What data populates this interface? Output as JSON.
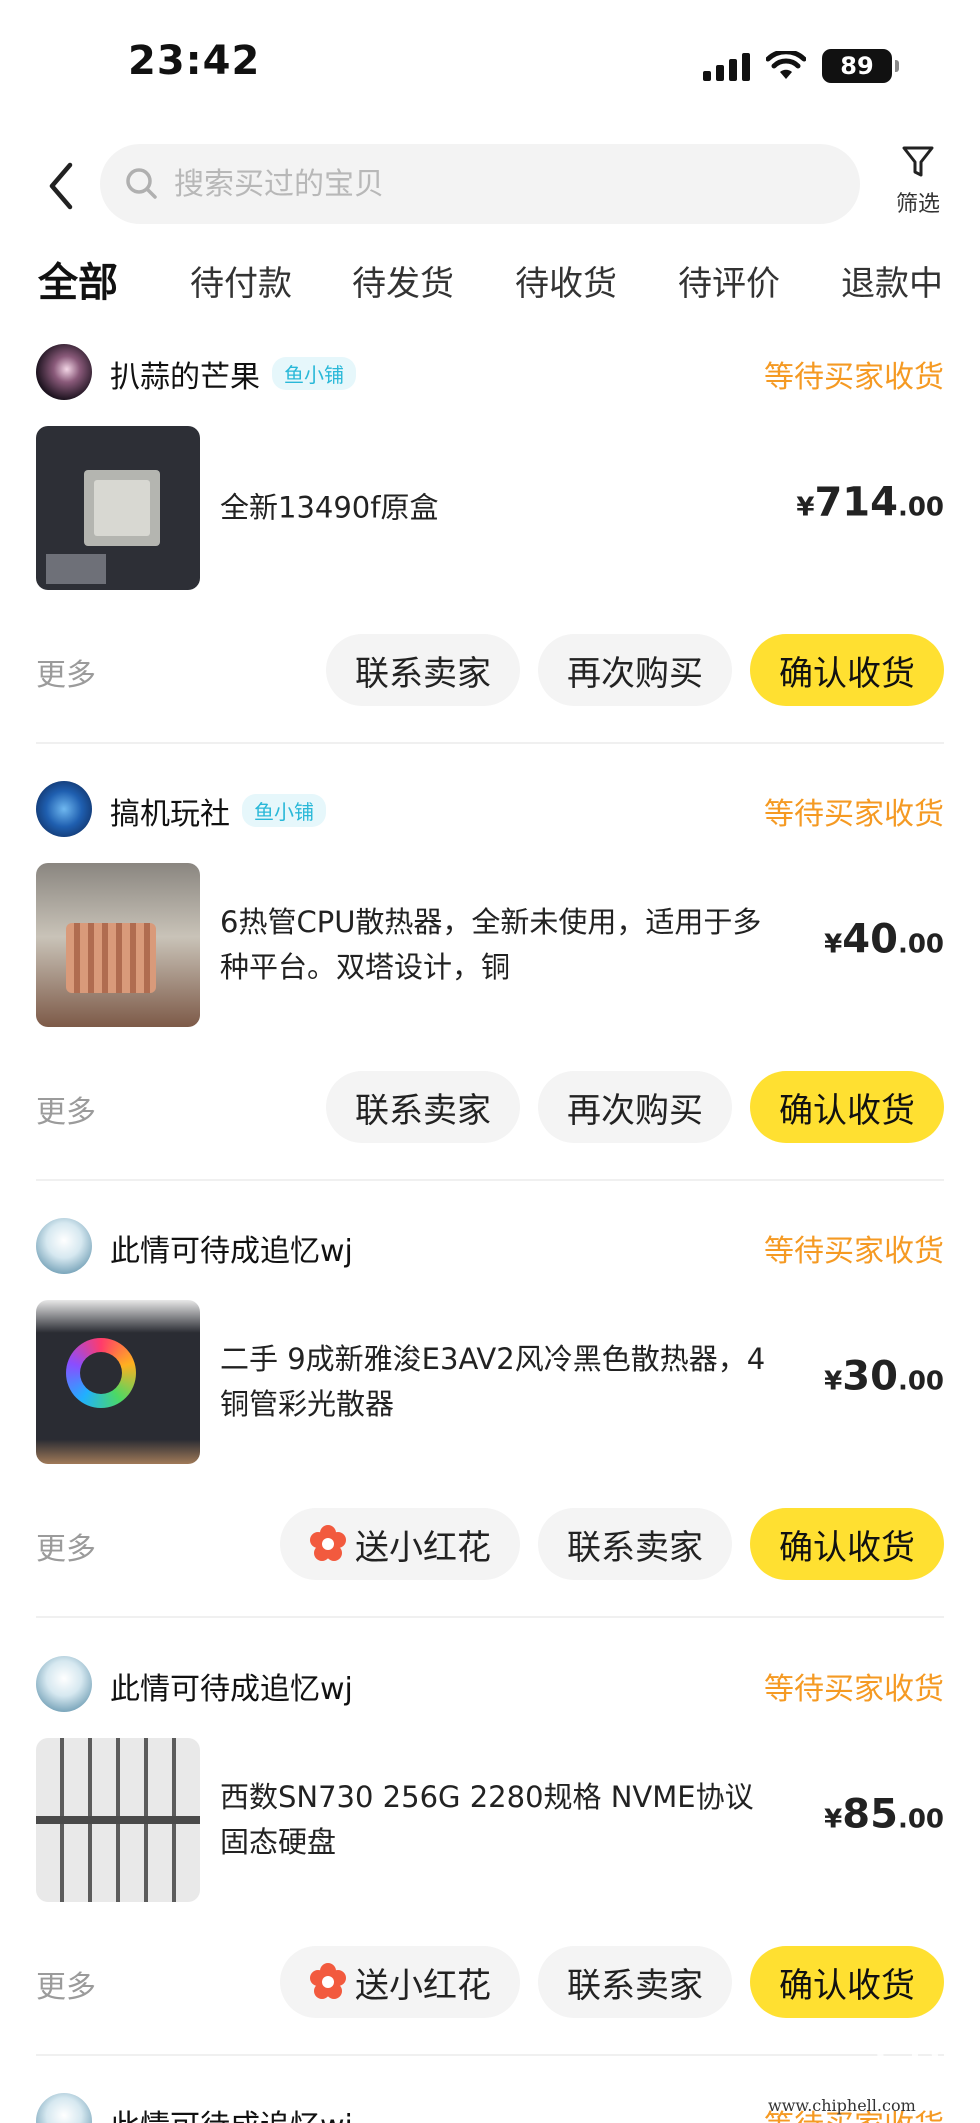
{
  "status_bar": {
    "time": "23:42",
    "battery": "89"
  },
  "search": {
    "placeholder": "搜索买过的宝贝",
    "filter_label": "筛选"
  },
  "tabs": [
    {
      "label": "全部",
      "active": true
    },
    {
      "label": "待付款"
    },
    {
      "label": "待发货"
    },
    {
      "label": "待收货"
    },
    {
      "label": "待评价"
    },
    {
      "label": "退款中"
    }
  ],
  "orders": [
    {
      "shop": "扒蒜的芒果",
      "badge": "鱼小铺",
      "status": "等待买家收货",
      "title": "全新13490f原盒",
      "price_symbol": "¥",
      "price_int": "714",
      "price_dec": ".00",
      "more": "更多",
      "buttons": [
        "联系卖家",
        "再次购买",
        "确认收货"
      ]
    },
    {
      "shop": "搞机玩社",
      "badge": "鱼小铺",
      "status": "等待买家收货",
      "title": "6热管CPU散热器，全新未使用，适用于多种平台。双塔设计，铜",
      "price_symbol": "¥",
      "price_int": "40",
      "price_dec": ".00",
      "more": "更多",
      "buttons": [
        "联系卖家",
        "再次购买",
        "确认收货"
      ]
    },
    {
      "shop": "此情可待成追忆wj",
      "status": "等待买家收货",
      "title": "二手 9成新雅浚E3AV2风冷黑色散热器，4铜管彩光散器",
      "price_symbol": "¥",
      "price_int": "30",
      "price_dec": ".00",
      "more": "更多",
      "buttons": [
        "送小红花",
        "联系卖家",
        "确认收货"
      ]
    },
    {
      "shop": "此情可待成追忆wj",
      "status": "等待买家收货",
      "title": "西数SN730 256G 2280规格 NVME协议固态硬盘",
      "price_symbol": "¥",
      "price_int": "85",
      "price_dec": ".00",
      "more": "更多",
      "buttons": [
        "送小红花",
        "联系卖家",
        "确认收货"
      ]
    },
    {
      "shop": "此情可待成追忆wj",
      "status": "等待买家收货"
    }
  ],
  "watermark": {
    "text": "www.chiphell.com"
  },
  "colors": {
    "accent": "#ffe031",
    "status": "#f59a23",
    "badge": "#29b8d8"
  }
}
